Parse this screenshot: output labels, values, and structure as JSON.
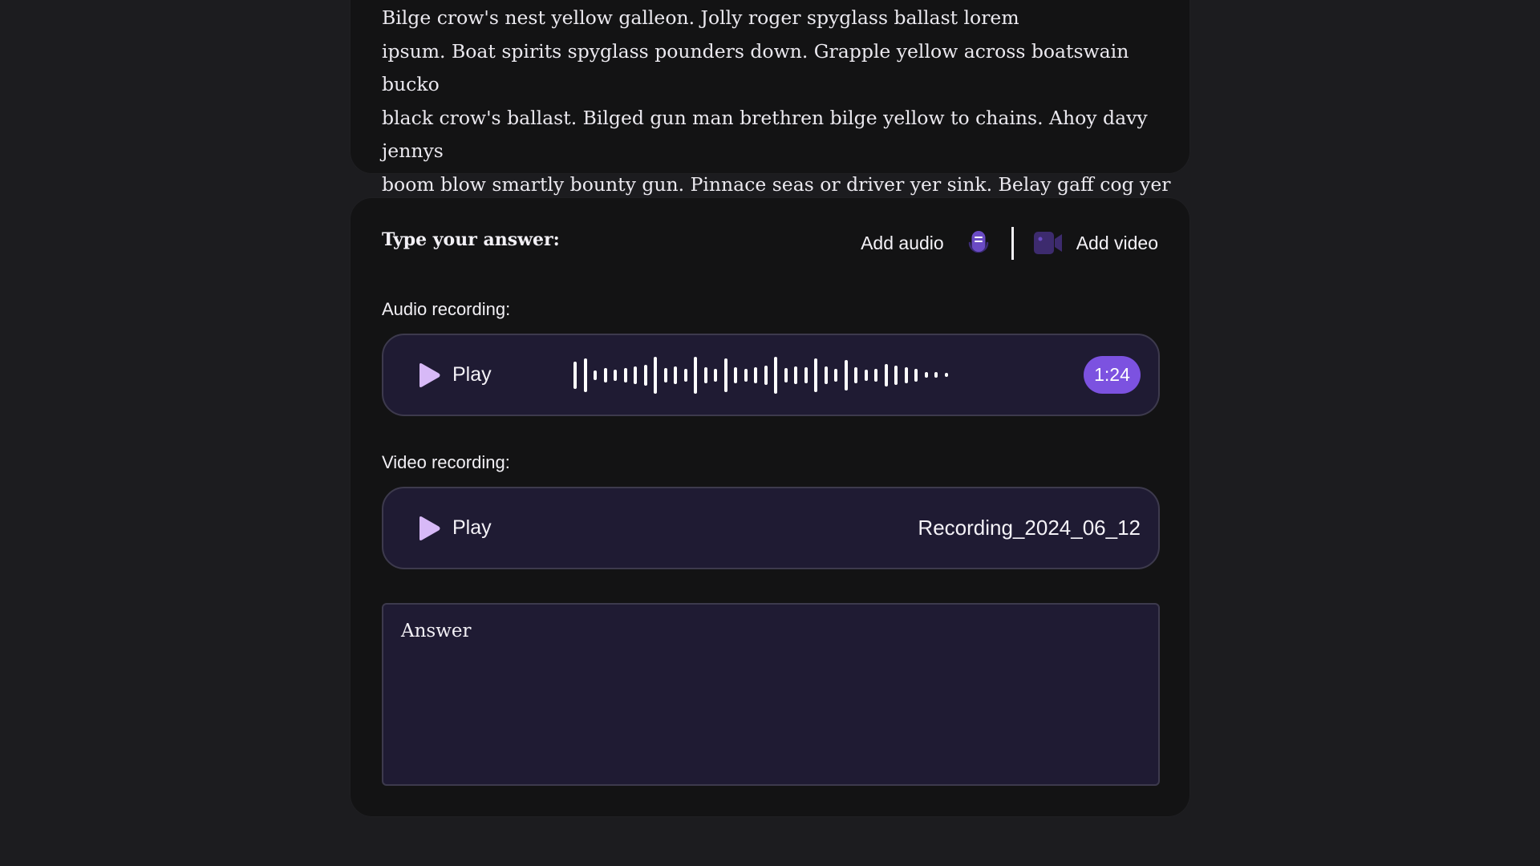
{
  "question": {
    "text": "Bilge crow's nest yellow galleon. Jolly roger spyglass ballast lorem\nipsum. Boat spirits spyglass pounders down. Grapple yellow across boatswain bucko\nblack crow's ballast. Bilged gun man brethren bilge yellow to chains. Ahoy davy jennys\nboom blow smartly bounty gun. Pinnace seas or driver yer sink. Belay gaff cog yer\nbilge cat hearties."
  },
  "answer_form": {
    "heading": "Type your answer:",
    "add_audio_label": "Add audio",
    "add_video_label": "Add video",
    "audio_section_label": "Audio recording:",
    "video_section_label": "Video recording:",
    "audio_player": {
      "play_label": "Play",
      "duration": "1:24"
    },
    "video_player": {
      "play_label": "Play",
      "file_name": "Recording_2024_06_12"
    },
    "answer_placeholder": "Answer",
    "answer_value": ""
  },
  "colors": {
    "page_background": "#1c1c1f",
    "card_background": "#131314",
    "player_background": "#1f1b33",
    "accent": "#7c52e0",
    "play_icon": "#d7b9f7",
    "mic_icon": "#6a4bc4",
    "camera_icon": "#3d2b6e",
    "text": "#f2f0f5"
  },
  "icons": {
    "add_audio": "microphone-icon",
    "add_video": "video-camera-icon",
    "play": "play-icon"
  }
}
